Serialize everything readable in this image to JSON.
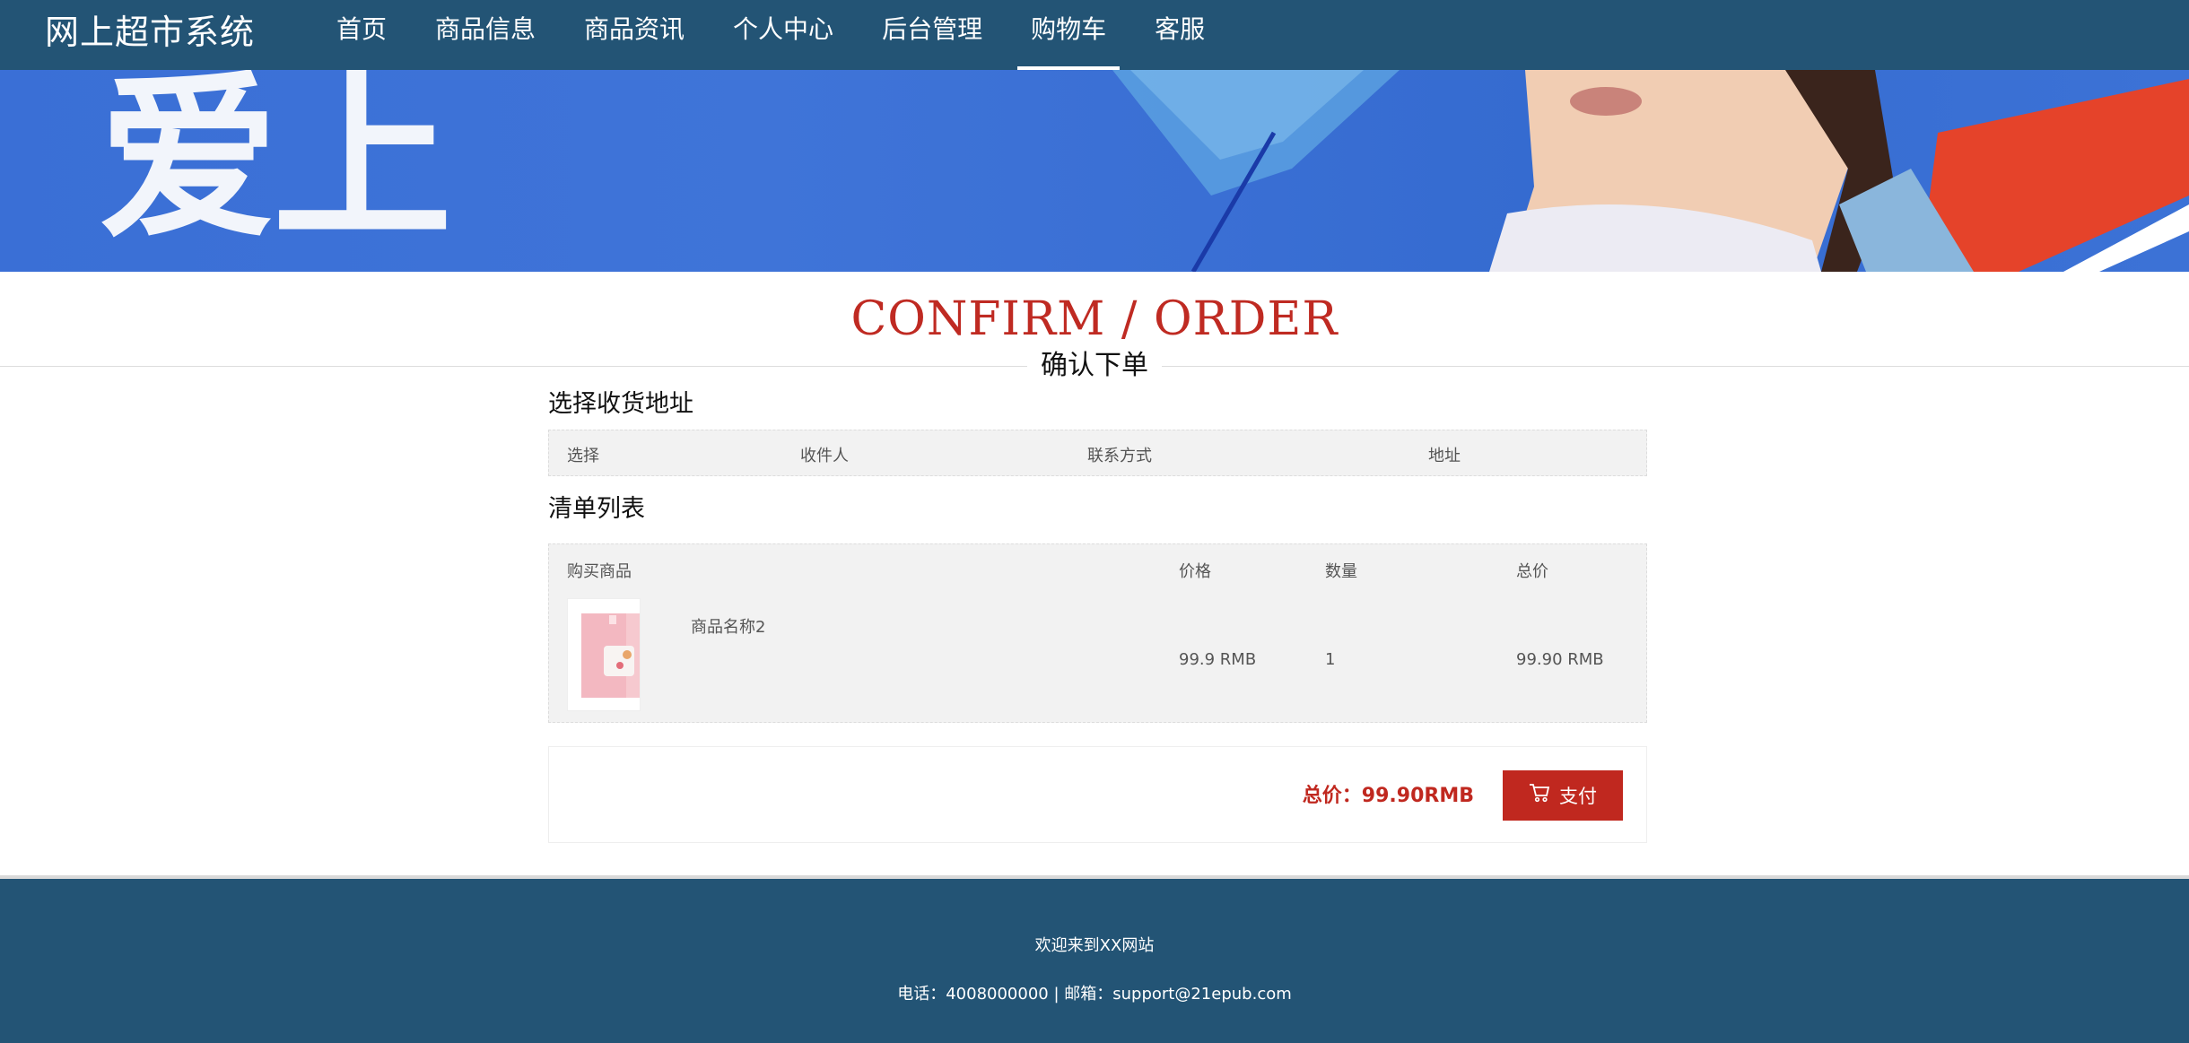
{
  "header": {
    "brand": "网上超市系统",
    "nav": [
      {
        "label": "首页",
        "active": false
      },
      {
        "label": "商品信息",
        "active": false
      },
      {
        "label": "商品资讯",
        "active": false
      },
      {
        "label": "个人中心",
        "active": false
      },
      {
        "label": "后台管理",
        "active": false
      },
      {
        "label": "购物车",
        "active": true
      },
      {
        "label": "客服",
        "active": false
      }
    ]
  },
  "banner": {
    "text": "爱上"
  },
  "page": {
    "title_en": "CONFIRM / ORDER",
    "title_cn": "确认下单"
  },
  "address": {
    "heading": "选择收货地址",
    "columns": [
      "选择",
      "收件人",
      "联系方式",
      "地址"
    ]
  },
  "order_list": {
    "heading": "清单列表",
    "columns": [
      "购买商品",
      "价格",
      "数量",
      "总价"
    ],
    "rows": [
      {
        "name": "商品名称2",
        "price": "99.9 RMB",
        "quantity": "1",
        "total": "99.90 RMB"
      }
    ]
  },
  "payment": {
    "total_label": "总价：99.90RMB",
    "pay_button": "支付",
    "accent": "#c0281f"
  },
  "footer": {
    "line1": "欢迎来到XX网站",
    "line2": "电话：4008000000 | 邮箱：support@21epub.com"
  },
  "colors": {
    "header_bg": "#235475",
    "accent": "#c0281f"
  }
}
